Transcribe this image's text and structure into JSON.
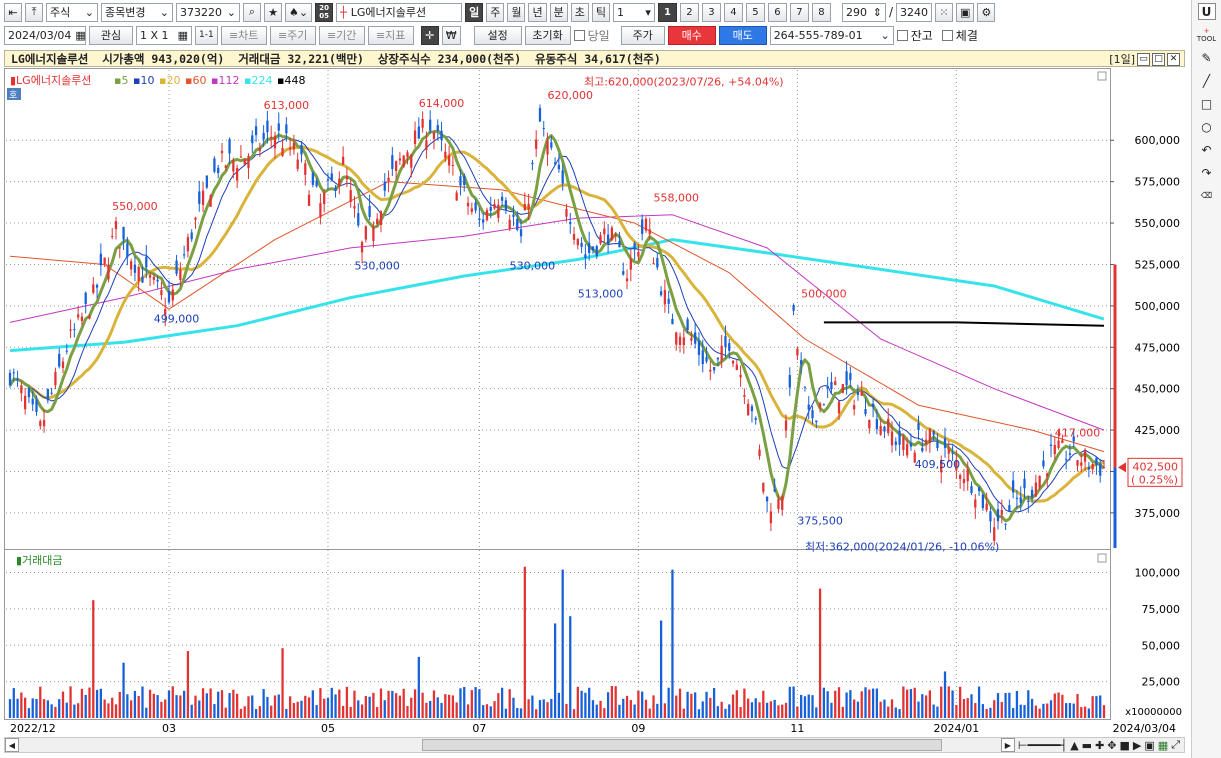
{
  "toolbar": {
    "market": "주식",
    "code_change": "종목변경",
    "code": "373220",
    "period_badge": "20\n05",
    "stock_name": "LG에너지솔루션",
    "periods": [
      "일",
      "주",
      "월",
      "년",
      "분",
      "초",
      "틱"
    ],
    "period_value": "1",
    "pages": [
      "1",
      "2",
      "3",
      "4",
      "5",
      "6",
      "7",
      "8"
    ],
    "count": "290",
    "total": "3240",
    "slash": "/"
  },
  "toolbar2": {
    "date": "2024/03/04",
    "interest": "관심",
    "layout": "1 X 1",
    "layout_small": "1-1",
    "chart": "≡차트",
    "period": "≡주기",
    "term": "≡기간",
    "indicator": "≡지표",
    "won": "₩",
    "settings": "설정",
    "reset": "초기화",
    "today": "당일",
    "price": "주가",
    "buy": "매수",
    "sell": "매도",
    "account": "264-555-789-01",
    "balance": "잔고",
    "filled": "체결"
  },
  "info": {
    "name": "LG에너지솔루션",
    "market_cap": "시가총액 943,020(억)",
    "trade_amount": "거래대금 32,221(백만)",
    "listed_shares": "상장주식수 234,000(천주)",
    "float_shares": "유동주식 34,617(천주)",
    "interval": "[1일]"
  },
  "colors": {
    "up": "#e23232",
    "down": "#1660d8",
    "ma5": "#7aa043",
    "ma10": "#1d3fb8",
    "ma20": "#d9b33a",
    "ma60": "#e0542a",
    "ma112": "#c237c2",
    "ma224": "#37e3ea",
    "ma448": "#000000"
  },
  "chart_data": [
    {
      "type": "candlestick",
      "legend": [
        {
          "name": "LG에너지솔루션",
          "color": "#e23232"
        },
        {
          "name": "5",
          "color": "#7aa043"
        },
        {
          "name": "10",
          "color": "#1d3fb8"
        },
        {
          "name": "20",
          "color": "#d9b33a"
        },
        {
          "name": "60",
          "color": "#e0542a"
        },
        {
          "name": "112",
          "color": "#c237c2"
        },
        {
          "name": "224",
          "color": "#37e3ea"
        },
        {
          "name": "448",
          "color": "#000000"
        }
      ],
      "ylim": [
        355000,
        640000
      ],
      "y_ticks": [
        375000,
        400000,
        425000,
        450000,
        475000,
        500000,
        525000,
        550000,
        575000,
        600000
      ],
      "y_tick_labels": [
        "375,000",
        "400,000",
        "425,000",
        "450,000",
        "475,000",
        "500,000",
        "525,000",
        "550,000",
        "575,000",
        "600,000"
      ],
      "x_labels": [
        "2022/12",
        "03",
        "05",
        "07",
        "09",
        "11",
        "2024/01",
        "2024/03/04"
      ],
      "x_label_index": [
        0,
        42,
        84,
        124,
        166,
        208,
        250,
        290
      ],
      "n": 290,
      "close_path": [
        [
          0,
          460000
        ],
        [
          8,
          425000
        ],
        [
          15,
          475000
        ],
        [
          22,
          505000
        ],
        [
          28,
          545000
        ],
        [
          35,
          520000
        ],
        [
          42,
          500000
        ],
        [
          48,
          545000
        ],
        [
          55,
          585000
        ],
        [
          62,
          590000
        ],
        [
          70,
          605000
        ],
        [
          76,
          590000
        ],
        [
          82,
          560000
        ],
        [
          88,
          585000
        ],
        [
          93,
          535000
        ],
        [
          99,
          570000
        ],
        [
          105,
          595000
        ],
        [
          111,
          610000
        ],
        [
          117,
          580000
        ],
        [
          124,
          550000
        ],
        [
          130,
          570000
        ],
        [
          135,
          540000
        ],
        [
          140,
          610000
        ],
        [
          146,
          570000
        ],
        [
          152,
          530000
        ],
        [
          158,
          545000
        ],
        [
          163,
          520000
        ],
        [
          168,
          550000
        ],
        [
          174,
          495000
        ],
        [
          180,
          480000
        ],
        [
          186,
          458000
        ],
        [
          190,
          480000
        ],
        [
          196,
          440000
        ],
        [
          200,
          380000
        ],
        [
          204,
          390000
        ],
        [
          207,
          490000
        ],
        [
          211,
          430000
        ],
        [
          215,
          445000
        ],
        [
          220,
          450000
        ],
        [
          225,
          445000
        ],
        [
          230,
          430000
        ],
        [
          236,
          415000
        ],
        [
          242,
          420000
        ],
        [
          248,
          410000
        ],
        [
          254,
          395000
        ],
        [
          260,
          370000
        ],
        [
          265,
          380000
        ],
        [
          270,
          390000
        ],
        [
          275,
          410000
        ],
        [
          280,
          412000
        ],
        [
          285,
          405000
        ],
        [
          289,
          402500
        ]
      ],
      "ma_anchors": {
        "ma224": [
          [
            0,
            473000
          ],
          [
            30,
            478000
          ],
          [
            60,
            488000
          ],
          [
            90,
            505000
          ],
          [
            120,
            518000
          ],
          [
            150,
            528000
          ],
          [
            175,
            540000
          ],
          [
            200,
            532000
          ],
          [
            230,
            522000
          ],
          [
            260,
            512000
          ],
          [
            289,
            492000
          ]
        ],
        "ma112": [
          [
            0,
            490000
          ],
          [
            30,
            505000
          ],
          [
            60,
            522000
          ],
          [
            90,
            535000
          ],
          [
            120,
            542000
          ],
          [
            150,
            553000
          ],
          [
            175,
            555000
          ],
          [
            200,
            535000
          ],
          [
            230,
            480000
          ],
          [
            260,
            450000
          ],
          [
            289,
            425000
          ]
        ],
        "ma60": [
          [
            0,
            530000
          ],
          [
            25,
            525000
          ],
          [
            42,
            498000
          ],
          [
            70,
            540000
          ],
          [
            100,
            575000
          ],
          [
            130,
            570000
          ],
          [
            165,
            550000
          ],
          [
            190,
            520000
          ],
          [
            210,
            480000
          ],
          [
            240,
            440000
          ],
          [
            270,
            425000
          ],
          [
            289,
            412000
          ]
        ],
        "ma448": [
          [
            215,
            490000
          ],
          [
            250,
            490000
          ],
          [
            289,
            488000
          ]
        ]
      },
      "annotations": [
        {
          "label": "550,000",
          "index": 33,
          "value": 558000,
          "color": "#e23232"
        },
        {
          "label": "499,000",
          "index": 44,
          "value": 490000,
          "color": "#1d3fb8"
        },
        {
          "label": "613,000",
          "index": 73,
          "value": 619000,
          "color": "#e23232"
        },
        {
          "label": "530,000",
          "index": 97,
          "value": 522000,
          "color": "#1d3fb8"
        },
        {
          "label": "614,000",
          "index": 114,
          "value": 620000,
          "color": "#e23232"
        },
        {
          "label": "530,000",
          "index": 138,
          "value": 522000,
          "color": "#1d3fb8"
        },
        {
          "label": "620,000",
          "index": 148,
          "value": 625000,
          "color": "#e23232"
        },
        {
          "label": "513,000",
          "index": 156,
          "value": 505000,
          "color": "#1d3fb8"
        },
        {
          "label": "558,000",
          "index": 176,
          "value": 563000,
          "color": "#e23232"
        },
        {
          "label": "500,000",
          "index": 215,
          "value": 505000,
          "color": "#e23232"
        },
        {
          "label": "375,500",
          "index": 214,
          "value": 368000,
          "color": "#1d3fb8"
        },
        {
          "label": "409,500",
          "index": 245,
          "value": 402000,
          "color": "#1d3fb8"
        },
        {
          "label": "417,000",
          "index": 282,
          "value": 421000,
          "color": "#e23232"
        }
      ],
      "high_note": "최고:620,000(2023/07/26, +54.04%)",
      "low_note": "최저:362,000(2024/01/26, -10.06%)",
      "last_price": "402,500",
      "last_change": "( 0.25%)",
      "last_value": 402500
    },
    {
      "type": "bar",
      "title": "거래대금",
      "ylim": [
        0,
        110000
      ],
      "y_ticks": [
        25000,
        50000,
        75000,
        100000
      ],
      "y_tick_labels": [
        "25,000",
        "50,000",
        "75,000",
        "100,000"
      ],
      "unit": "x10000000",
      "spikes": [
        [
          22,
          81000
        ],
        [
          30,
          38000
        ],
        [
          47,
          46000
        ],
        [
          72,
          48000
        ],
        [
          108,
          42000
        ],
        [
          136,
          104000
        ],
        [
          144,
          65000
        ],
        [
          146,
          102000
        ],
        [
          148,
          70000
        ],
        [
          172,
          67000
        ],
        [
          175,
          102000
        ],
        [
          214,
          89000
        ],
        [
          247,
          32000
        ],
        [
          286,
          15000
        ]
      ]
    }
  ]
}
